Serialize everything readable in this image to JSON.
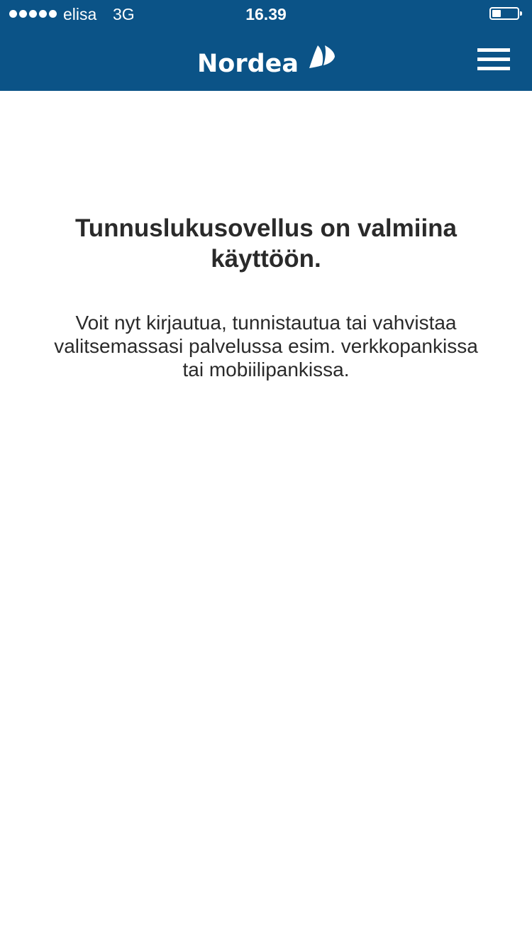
{
  "status_bar": {
    "carrier": "elisa",
    "network": "3G",
    "time": "16.39",
    "battery_level": 0.35
  },
  "header": {
    "brand": "Nordea",
    "background_color": "#0b5387",
    "menu_icon": "hamburger-menu-icon"
  },
  "main": {
    "title": "Tunnuslukusovellus on valmiina käyttöön.",
    "description": "Voit nyt kirjautua, tunnistautua tai vahvistaa valitsemassasi palvelussa esim. verkkopankissa tai mobiilipankissa."
  }
}
